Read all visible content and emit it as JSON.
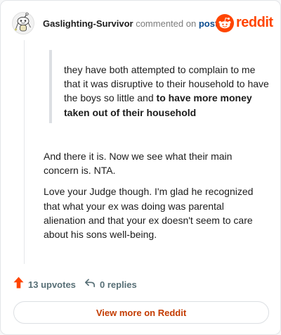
{
  "header": {
    "username": "Gaslighting-Survivor",
    "commented_on": "commented on",
    "post_link": "post",
    "brand_name": "reddit"
  },
  "quote": {
    "text": "they have both attempted to complain to me that it was disruptive to their household to have the boys so little and",
    "bold_text": "to have more money taken out of their household"
  },
  "comment": {
    "paragraphs": [
      "And there it is. Now we see what their main concern is. NTA.",
      "Love your Judge though. I'm glad he recognized that what your ex was doing was parental alienation and that your ex doesn't seem to care about his sons well-being."
    ]
  },
  "actions": {
    "upvotes": "13 upvotes",
    "replies": "0 replies"
  },
  "footer": {
    "view_more": "View more on Reddit"
  },
  "icons": {
    "avatar": "snoo-avatar-icon",
    "brand_logo": "reddit-logo-icon",
    "upvote": "upvote-arrow-icon",
    "reply": "reply-arrow-icon"
  },
  "colors": {
    "brand": "#ff4500",
    "upvote": "#ff4500",
    "link": "#0a4b8f",
    "muted": "#7c7c7c",
    "action_text": "#576f76",
    "view_more_text": "#c33b00"
  }
}
